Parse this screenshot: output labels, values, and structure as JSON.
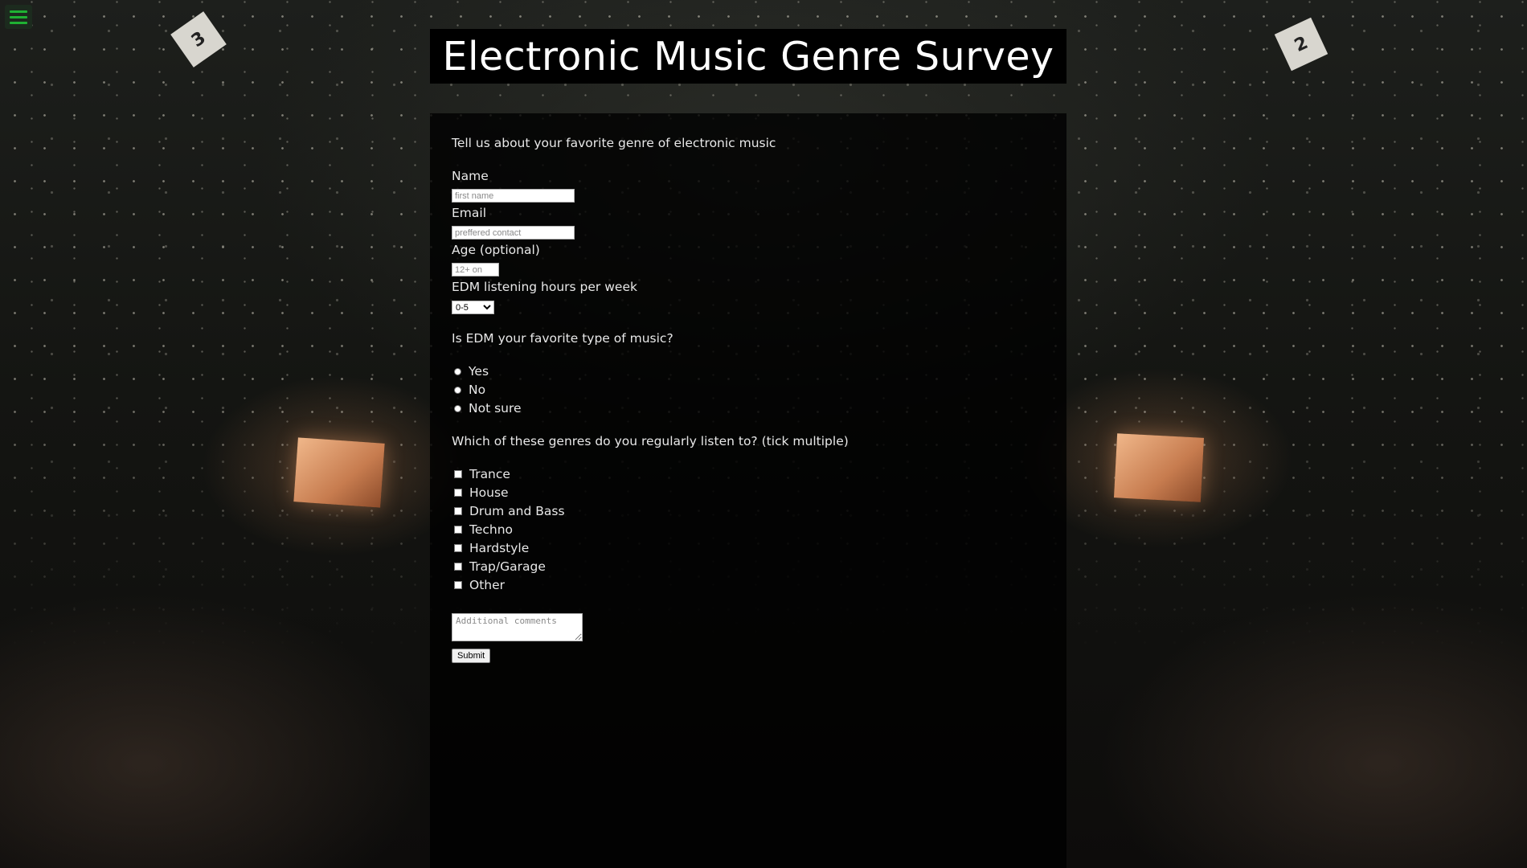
{
  "header": {
    "title": "Electronic Music Genre Survey"
  },
  "menu": {
    "icon": "hamburger-icon",
    "icon_color": "#1fb233"
  },
  "background_signs": [
    "3",
    "2"
  ],
  "form": {
    "intro": "Tell us about your favorite genre of electronic music",
    "name": {
      "label": "Name",
      "placeholder": "first name",
      "value": ""
    },
    "email": {
      "label": "Email",
      "placeholder": "preffered contact",
      "value": ""
    },
    "age": {
      "label": "Age (optional)",
      "placeholder": "12+ on",
      "value": ""
    },
    "hours": {
      "label": "EDM listening hours per week",
      "selected": "0-5"
    },
    "favorite": {
      "question": "Is EDM your favorite type of music?",
      "options": [
        "Yes",
        "No",
        "Not sure"
      ]
    },
    "genres": {
      "question": "Which of these genres do you regularly listen to? (tick multiple)",
      "options": [
        "Trance",
        "House",
        "Drum and Bass",
        "Techno",
        "Hardstyle",
        "Trap/Garage",
        "Other"
      ]
    },
    "comments": {
      "placeholder": "Additional comments"
    },
    "submit_label": "Submit"
  }
}
